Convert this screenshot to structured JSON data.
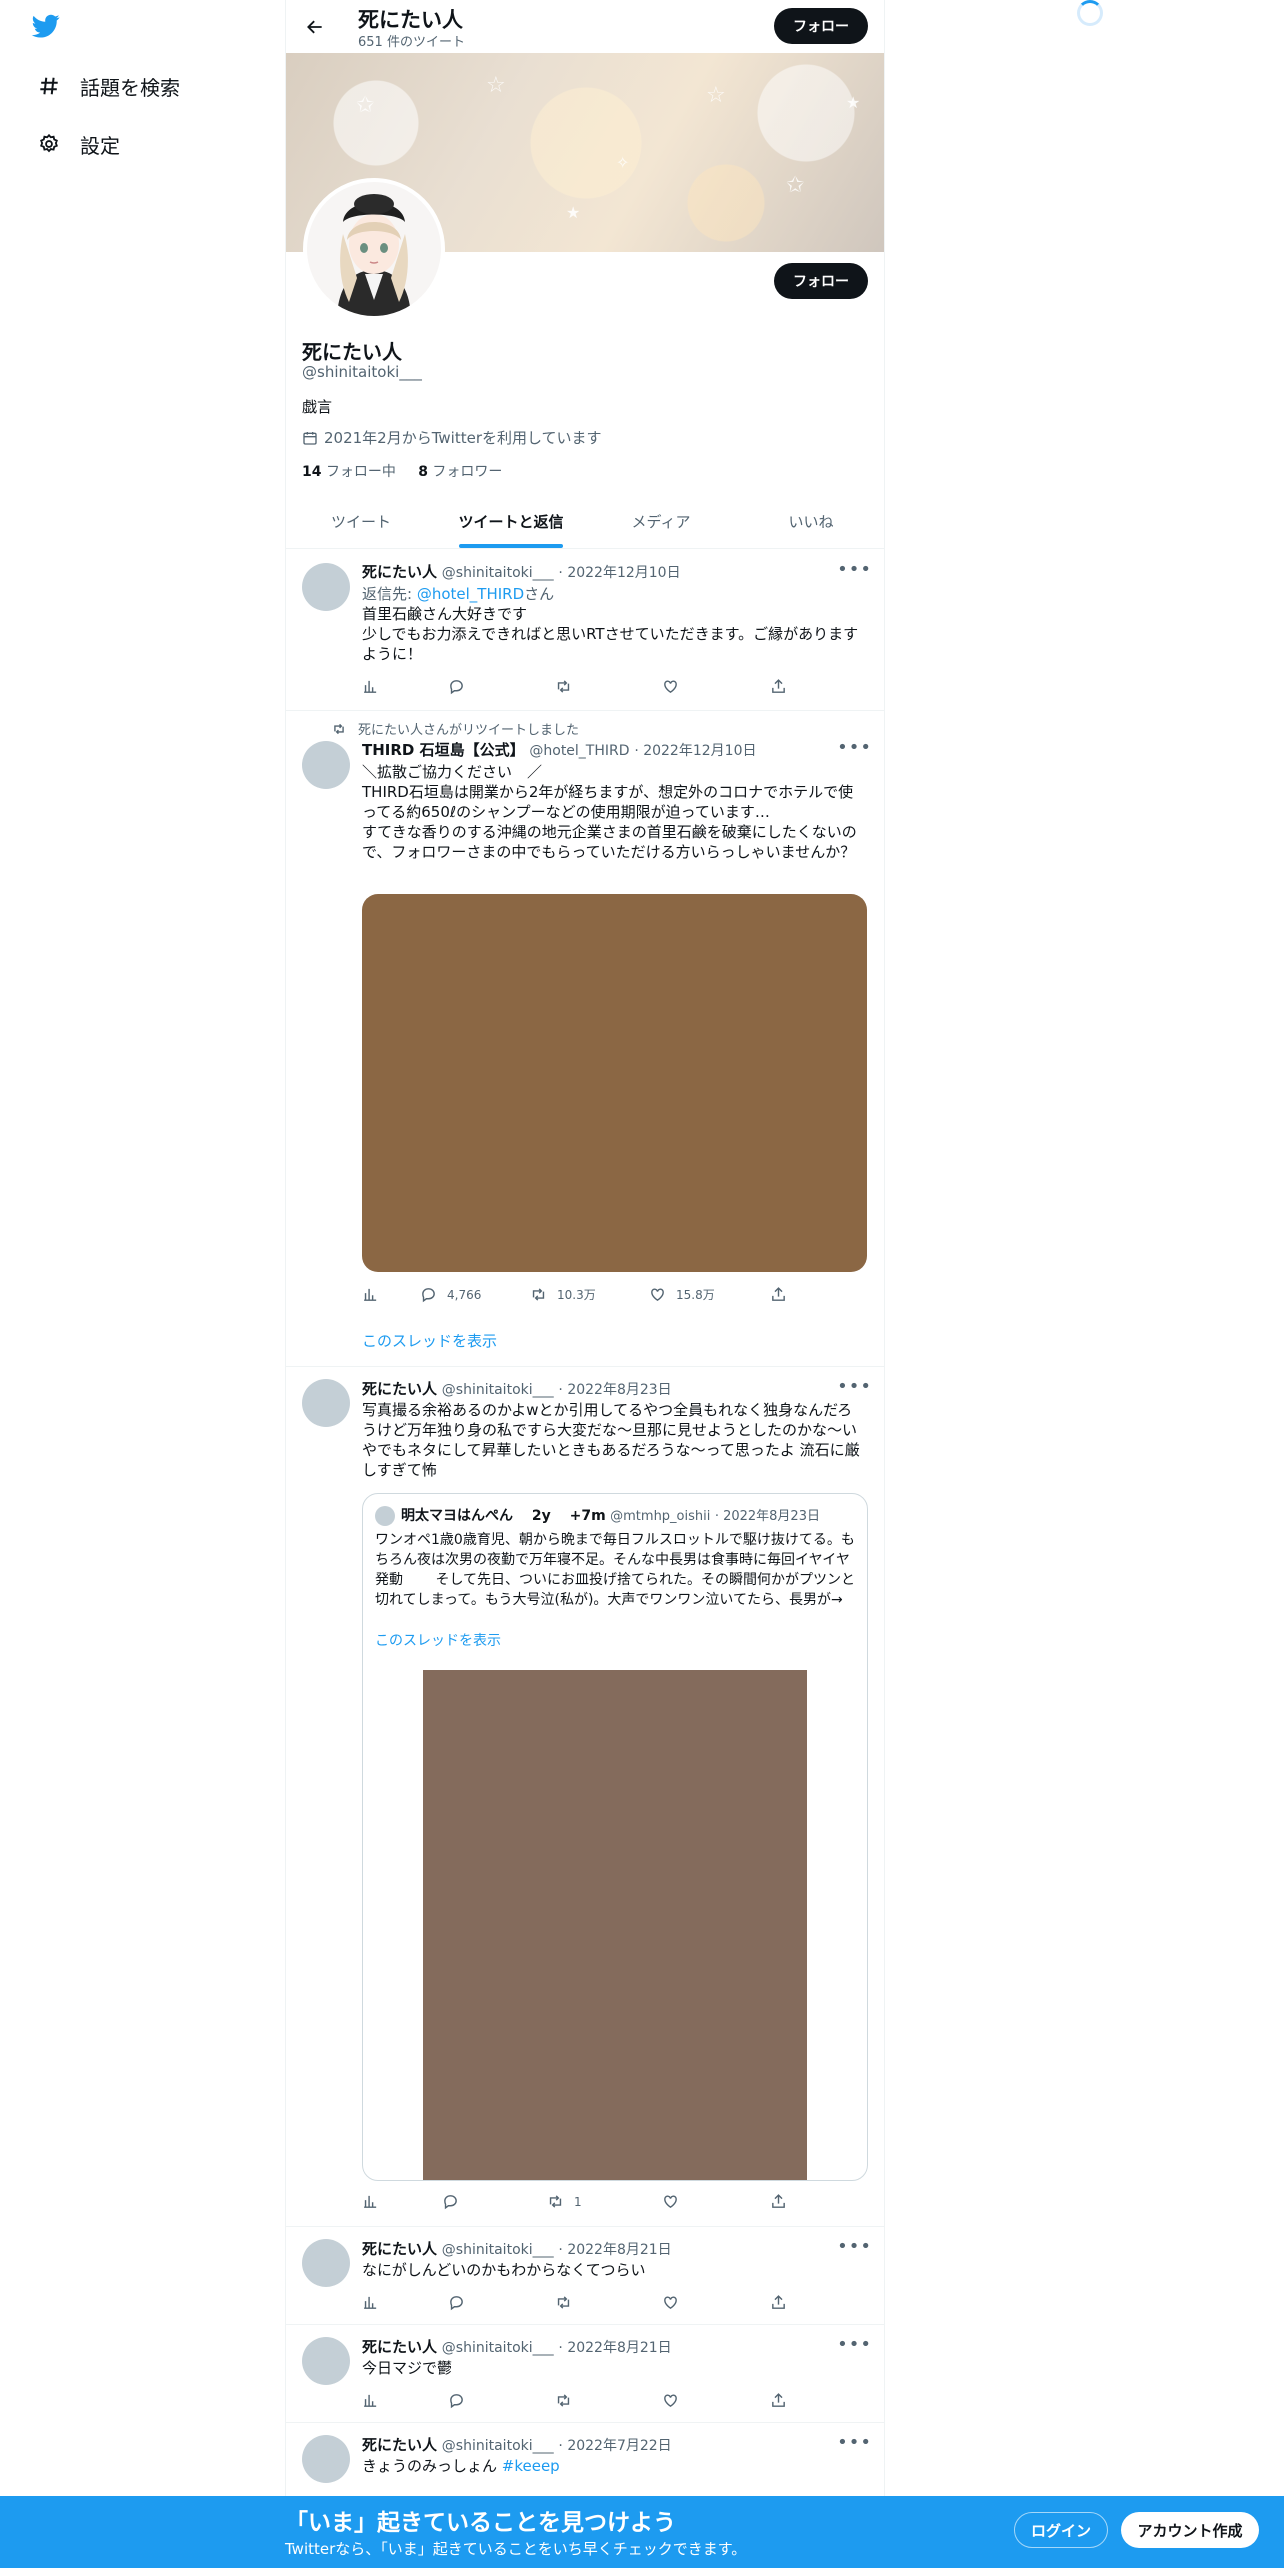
{
  "nav": {
    "explore_label": "話題を検索",
    "settings_label": "設定"
  },
  "header": {
    "name": "死にたい人",
    "tweet_count": "651 件のツイート",
    "follow_label": "フォロー"
  },
  "profile": {
    "name": "死にたい人",
    "handle": "@shinitaitoki___",
    "bio": "戯言",
    "joined": "2021年2月からTwitterを利用しています",
    "following_count": "14",
    "following_label": "フォロー中",
    "followers_count": "8",
    "followers_label": "フォロワー",
    "follow_label": "フォロー"
  },
  "tabs": [
    "ツイート",
    "ツイートと返信",
    "メディア",
    "いいね"
  ],
  "tweets": [
    {
      "name": "死にたい人",
      "handle": "@shinitaitoki___",
      "date": "· 2022年12月10日",
      "reply_prefix": "返信先: ",
      "reply_to": "@hotel_THIRD",
      "reply_suffix": "さん",
      "line1": "首里石鹸さん大好きです",
      "line2": "少しでもお力添えできればと思いRTさせていただきます。ご縁がありますように！"
    },
    {
      "retweet_label": "死にたい人さんがリツイートしました",
      "name": "THIRD 石垣島【公式】",
      "handle": "@hotel_THIRD",
      "date": "· 2022年12月10日",
      "line1": "＼拡散ご協力ください　／",
      "line2": "THIRD石垣島は開業から2年が経ちますが、想定外のコロナでホテルで使ってる約650ℓのシャンプーなどの使用期限が迫っています…",
      "line3": "すてきな香りのする沖縄の地元企業さまの首里石鹸を破棄にしたくないので、フォロワーさまの中でもらっていただける方いらっしゃいませんか？",
      "replies": "4,766",
      "retweets": "10.3万",
      "likes": "15.8万",
      "show_thread": "このスレッドを表示",
      "media_color": "#8b6744"
    },
    {
      "name": "死にたい人",
      "handle": "@shinitaitoki___",
      "date": "· 2022年8月23日",
      "text": "写真撮る余裕あるのかよwとか引用してるやつ全員もれなく独身なんだろうけど万年独り身の私ですら大変だな〜旦那に見せようとしたのかな〜いやでもネタにして昇華したいときもあるだろうな〜って思ったよ 流石に厳しすぎて怖",
      "retweets": "1",
      "quote": {
        "name": "明太マヨはんぺん　 2y　 +7m",
        "handle": "@mtmhp_oishii",
        "date": "· 2022年8月23日",
        "text": "ワンオペ1歳0歳育児、朝から晩まで毎日フルスロットルで駆け抜けてる。もちろん夜は次男の夜勤で万年寝不足。そんな中長男は食事時に毎回イヤイヤ発動　　 そして先日、ついにお皿投げ捨てられた。その瞬間何かがプツンと切れてしまって。もう大号泣(私が)。大声でワンワン泣いてたら、長男が→",
        "show_thread": "このスレッドを表示",
        "media_color": "#846b5c"
      }
    },
    {
      "name": "死にたい人",
      "handle": "@shinitaitoki___",
      "date": "· 2022年8月21日",
      "text": "なにがしんどいのかもわからなくてつらい"
    },
    {
      "name": "死にたい人",
      "handle": "@shinitaitoki___",
      "date": "· 2022年8月21日",
      "text": "今日マジで鬱"
    },
    {
      "name": "死にたい人",
      "handle": "@shinitaitoki___",
      "date": "· 2022年7月22日",
      "text": "きょうのみっしょん ",
      "hashtag": "#keeep"
    }
  ],
  "bottom_bar": {
    "title": "「いま」起きていることを見つけよう",
    "subtitle": "Twitterなら、「いま」起きていることをいち早くチェックできます。",
    "login_label": "ログイン",
    "signup_label": "アカウント作成"
  },
  "colors": {
    "accent": "#1d9bf0",
    "text": "#0f1419",
    "muted": "#536471"
  }
}
